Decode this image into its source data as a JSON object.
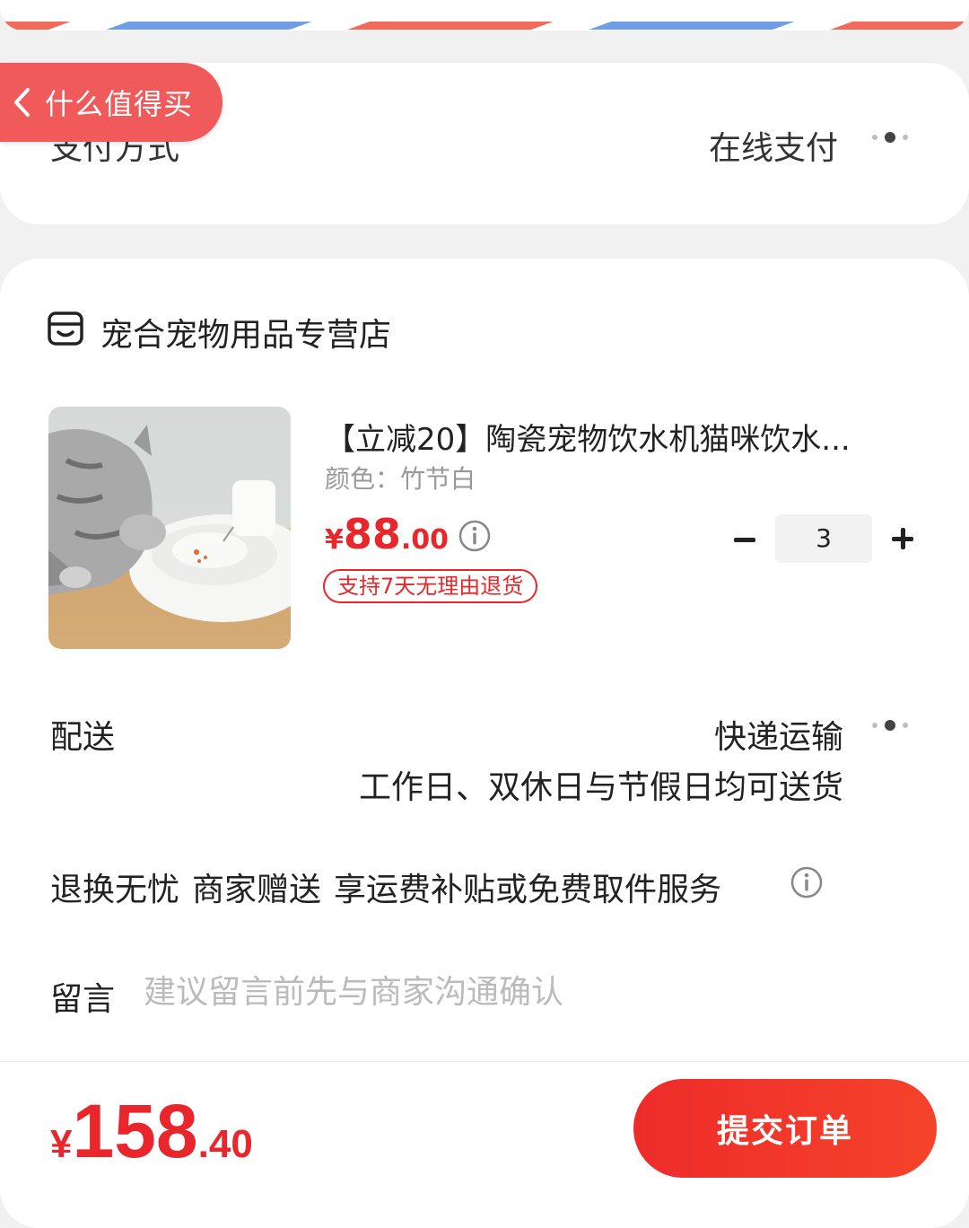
{
  "nav": {
    "back_label": "什么值得买"
  },
  "payment": {
    "label": "支付方式",
    "value": "在线支付"
  },
  "store": {
    "name": "宠合宠物用品专营店"
  },
  "product": {
    "title": "【立减20】陶瓷宠物饮水机猫咪饮水...",
    "spec": "颜色：竹节白",
    "price_currency": "¥",
    "price_integer": "88",
    "price_decimal": ".00",
    "return_badge": "支持7天无理由退货",
    "quantity": "3"
  },
  "shipping": {
    "label": "配送",
    "method": "快递运输",
    "note": "工作日、双休日与节假日均可送货"
  },
  "service": {
    "part1": "退换无忧",
    "part2": "商家赠送",
    "part3": "享运费补贴或免费取件服务"
  },
  "message": {
    "label": "留言",
    "placeholder": "建议留言前先与商家沟通确认"
  },
  "footer": {
    "total_currency": "¥",
    "total_integer": "158",
    "total_decimal": ".40",
    "submit_label": "提交订单"
  },
  "colors": {
    "accent": "#e8262b",
    "back_pill": "#f05a5a"
  }
}
